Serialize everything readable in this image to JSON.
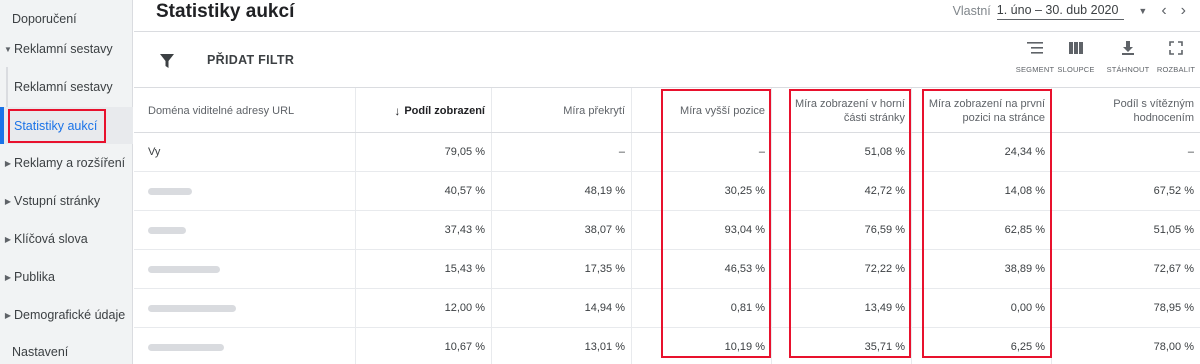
{
  "sidebar": {
    "items": [
      {
        "label": "Doporučení"
      },
      {
        "label": "Reklamní sestavy"
      },
      {
        "label": "Reklamní sestavy"
      },
      {
        "label": "Statistiky aukcí"
      },
      {
        "label": "Reklamy a rozšíření"
      },
      {
        "label": "Vstupní stránky"
      },
      {
        "label": "Klíčová slova"
      },
      {
        "label": "Publika"
      },
      {
        "label": "Demografické údaje"
      },
      {
        "label": "Nastavení"
      }
    ]
  },
  "header": {
    "title": "Statistiky aukcí",
    "date_label": "Vlastní",
    "date_range": "1. úno – 30. dub 2020"
  },
  "toolbar": {
    "add_filter": "PŘIDAT FILTR",
    "segment": "SEGMENT",
    "columns": "SLOUPCE",
    "download": "STÁHNOUT",
    "expand": "ROZBALIT"
  },
  "table": {
    "columns": [
      "Doména viditelné adresy URL",
      "Podíl zobrazení",
      "Míra překrytí",
      "Míra vyšší pozice",
      "Míra zobrazení v horní části stránky",
      "Míra zobrazení na první pozici na stránce",
      "Podíl s vítězným hodnocením"
    ],
    "rows": [
      {
        "domain": "Vy",
        "cells": [
          "79,05 %",
          "–",
          "–",
          "51,08 %",
          "24,34 %",
          "–"
        ]
      },
      {
        "domain": "",
        "cells": [
          "40,57 %",
          "48,19 %",
          "30,25 %",
          "42,72 %",
          "14,08 %",
          "67,52 %"
        ]
      },
      {
        "domain": "",
        "cells": [
          "37,43 %",
          "38,07 %",
          "93,04 %",
          "76,59 %",
          "62,85 %",
          "51,05 %"
        ]
      },
      {
        "domain": "",
        "cells": [
          "15,43 %",
          "17,35 %",
          "46,53 %",
          "72,22 %",
          "38,89 %",
          "72,67 %"
        ]
      },
      {
        "domain": "",
        "cells": [
          "12,00 %",
          "14,94 %",
          "0,81 %",
          "13,49 %",
          "0,00 %",
          "78,95 %"
        ]
      },
      {
        "domain": "",
        "cells": [
          "10,67 %",
          "13,01 %",
          "10,19 %",
          "35,71 %",
          "6,25 %",
          "78,00 %"
        ]
      }
    ]
  },
  "colors": {
    "accent": "#1a73e8",
    "highlight": "#e8112d"
  }
}
